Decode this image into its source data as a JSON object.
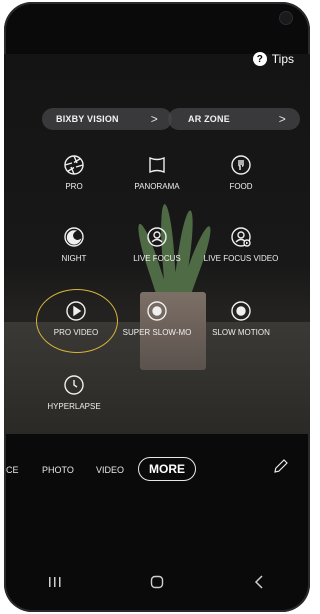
{
  "tips": {
    "label": "Tips",
    "badge": "?"
  },
  "quick_links": [
    {
      "label": "BIXBY VISION",
      "chevron": ">"
    },
    {
      "label": "AR ZONE",
      "chevron": ">"
    }
  ],
  "modes": [
    {
      "label": "PRO",
      "icon": "aperture-icon"
    },
    {
      "label": "PANORAMA",
      "icon": "panorama-icon"
    },
    {
      "label": "FOOD",
      "icon": "food-icon"
    },
    {
      "label": "NIGHT",
      "icon": "moon-icon"
    },
    {
      "label": "LIVE FOCUS",
      "icon": "live-focus-icon"
    },
    {
      "label": "LIVE FOCUS VIDEO",
      "icon": "live-focus-video-icon"
    },
    {
      "label": "PRO VIDEO",
      "icon": "play-icon"
    },
    {
      "label": "SUPER SLOW-MO",
      "icon": "super-slow-mo-icon"
    },
    {
      "label": "SLOW MOTION",
      "icon": "slow-motion-icon"
    },
    {
      "label": "HYPERLAPSE",
      "icon": "hyperlapse-icon"
    }
  ],
  "highlight_color": "#d6b43a",
  "mode_tabs": {
    "partial": "CE",
    "photo": "PHOTO",
    "video": "VIDEO",
    "more": "MORE"
  },
  "nav": {
    "recents": "|||",
    "home": "O",
    "back": "<"
  }
}
